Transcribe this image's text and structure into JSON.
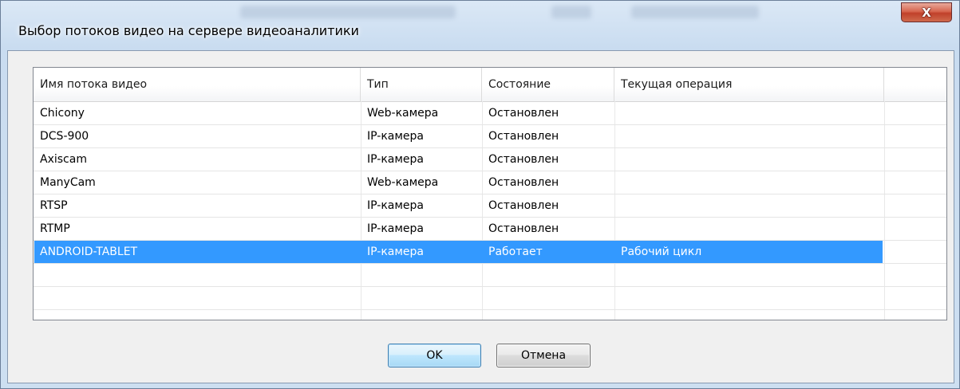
{
  "window": {
    "title": "Выбор потоков видео на сервере видеоаналитики",
    "close_glyph": "X"
  },
  "table": {
    "columns": [
      "Имя потока видео",
      "Тип",
      "Состояние",
      "Текущая операция"
    ],
    "rows": [
      [
        "Chicony",
        "Web-камера",
        "Остановлен",
        ""
      ],
      [
        "DCS-900",
        "IP-камера",
        "Остановлен",
        ""
      ],
      [
        "Axiscam",
        "IP-камера",
        "Остановлен",
        ""
      ],
      [
        "ManyCam",
        "Web-камера",
        "Остановлен",
        ""
      ],
      [
        "RTSP",
        "IP-камера",
        "Остановлен",
        ""
      ],
      [
        "RTMP",
        "IP-камера",
        "Остановлен",
        ""
      ],
      [
        "ANDROID-TABLET",
        "IP-камера",
        "Работает",
        "Рабочий цикл"
      ]
    ],
    "selected_row": 6
  },
  "buttons": {
    "ok_label": "OK",
    "cancel_label": "Отмена"
  },
  "colors": {
    "selection": "#3399ff",
    "close_button": "#c7503a"
  }
}
